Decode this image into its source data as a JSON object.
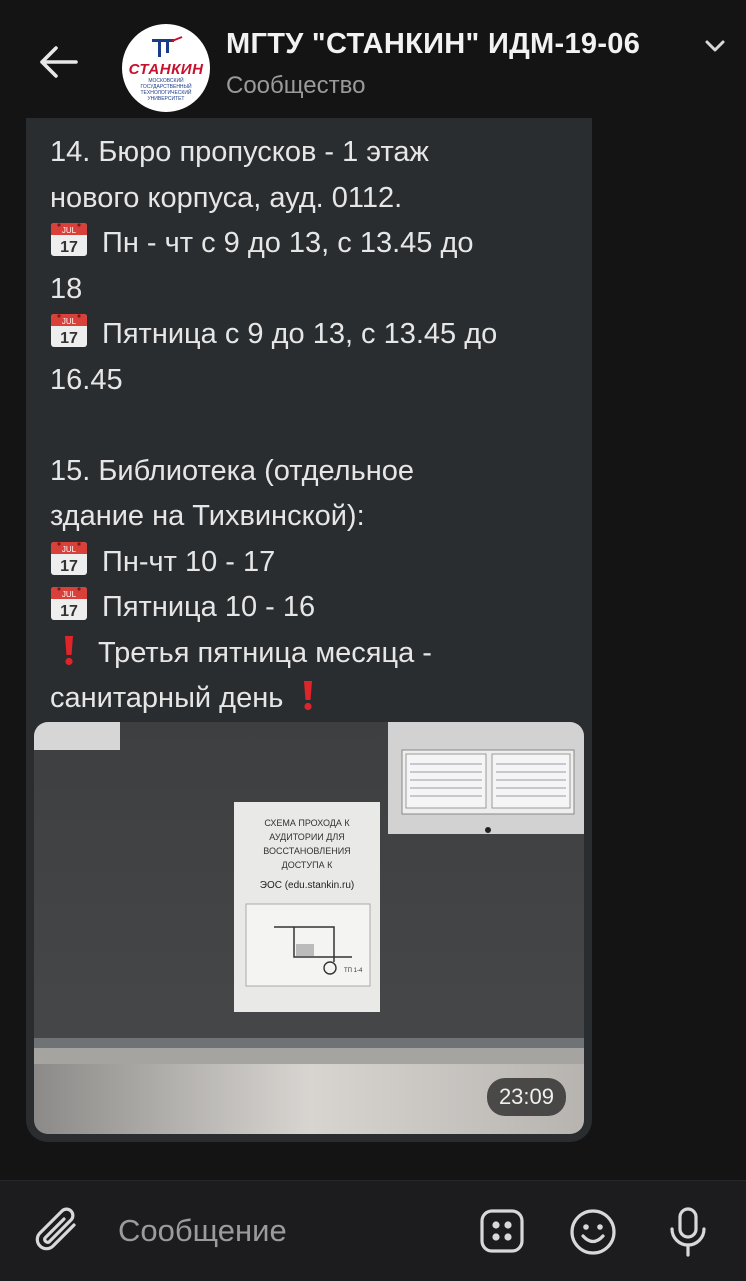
{
  "header": {
    "title": "МГТУ \"СТАНКИН\" ИДМ-19-06",
    "subtitle": "Сообщество",
    "avatar": {
      "brand": "СТАНКИН",
      "tagline": "МОСКОВСКИЙ ГОСУДАРСТВЕННЫЙ ТЕХНОЛОГИЧЕСКИЙ УНИВЕРСИТЕТ"
    }
  },
  "message": {
    "lines": [
      {
        "text": "14. Бюро пропусков - 1 этаж"
      },
      {
        "text": "нового корпуса, ауд. 0112."
      },
      {
        "icon": "calendar-icon",
        "text": "Пн - чт с 9 до 13, с 13.45 до"
      },
      {
        "text": "18"
      },
      {
        "icon": "calendar-icon",
        "text": "Пятница с 9 до 13, с 13.45 до"
      },
      {
        "text": "16.45"
      },
      {
        "text": ""
      },
      {
        "text": "15. Библиотека (отдельное"
      },
      {
        "text": "здание на Тихвинской):"
      },
      {
        "icon": "calendar-icon",
        "text": "Пн-чт 10 - 17"
      },
      {
        "icon": "calendar-icon",
        "text": "Пятница 10 - 16"
      },
      {
        "icon": "exclamation-icon",
        "text": "Третья пятница месяца -"
      },
      {
        "text": "санитарный день",
        "trailing_icon": "exclamation-icon"
      }
    ],
    "calendar_label": "JUL",
    "calendar_day": "17",
    "time": "23:09"
  },
  "photo": {
    "poster": {
      "title_lines": [
        "СХЕМА ПРОХОДА К",
        "АУДИТОРИИ ДЛЯ",
        "ВОССТАНОВЛЕНИЯ",
        "ДОСТУПА К"
      ],
      "link": "ЭОС (edu.stankin.ru)",
      "map_label": "ТП 1-4"
    }
  },
  "composer": {
    "placeholder": "Сообщение"
  },
  "colors": {
    "background": "#141414",
    "bubble": "#2a2d30",
    "text": "#e6e6e6",
    "muted": "#9a9a9a",
    "calendar_red": "#d9403a",
    "exclamation": "#e0242a"
  }
}
